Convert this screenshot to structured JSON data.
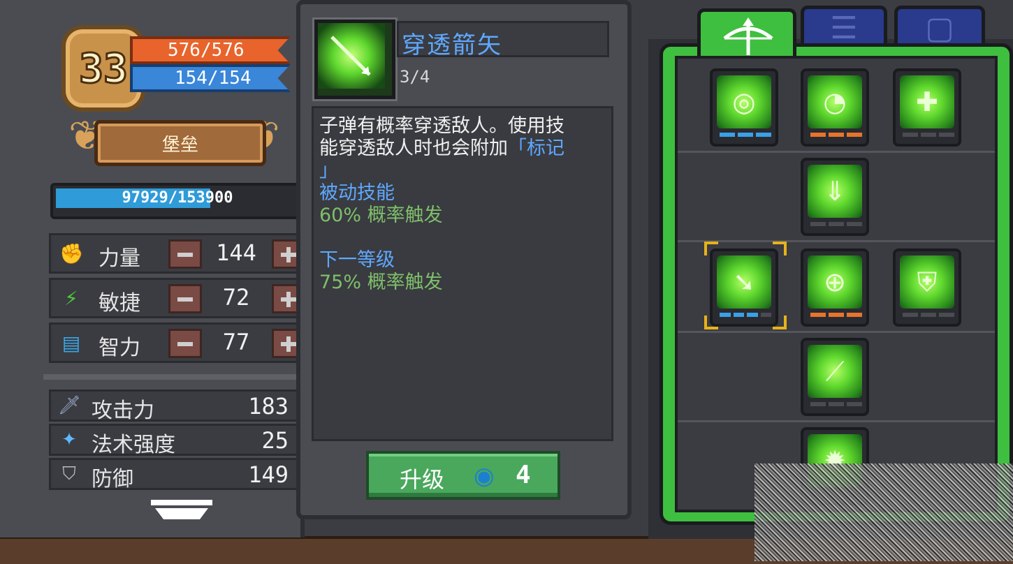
{
  "player": {
    "level": "33",
    "hp": "576/576",
    "mp": "154/154",
    "title": "堡垒",
    "xp": "97929/153900",
    "xp_fraction": 0.636
  },
  "stats": [
    {
      "label": "力量",
      "value": "144",
      "icon": "fist-icon"
    },
    {
      "label": "敏捷",
      "value": "72",
      "icon": "feather-icon"
    },
    {
      "label": "智力",
      "value": "77",
      "icon": "book-icon"
    }
  ],
  "attributes": [
    {
      "label": "攻击力",
      "value": "183",
      "icon": "sword-icon"
    },
    {
      "label": "法术强度",
      "value": "25",
      "icon": "wand-icon"
    },
    {
      "label": "防御",
      "value": "149",
      "icon": "shield-icon"
    }
  ],
  "skill": {
    "name": "穿透箭矢",
    "level": "3/4",
    "desc_line1": "子弹有概率穿透敌人。使用技",
    "desc_line2a": "能穿透敌人时也会附加",
    "desc_line2b": "「标记",
    "desc_line3": "」",
    "type": "被动技能",
    "current_effect": "60% 概率触发",
    "next_header": "下一等级",
    "next_effect": "75% 概率触发"
  },
  "upgrade": {
    "label": "升级",
    "cost": "4",
    "currency_icon": "swirl-gem-icon"
  },
  "tabs": [
    {
      "name": "crossbow-tab",
      "active": true
    },
    {
      "name": "tab-2",
      "active": false
    },
    {
      "name": "tab-3",
      "active": false
    }
  ],
  "colors": {
    "hp": "#e8642c",
    "mp": "#3a86d8",
    "accent_green": "#3fbf3f",
    "skill_name_blue": "#5fa8ff",
    "effect_green": "#7fbf6a"
  }
}
